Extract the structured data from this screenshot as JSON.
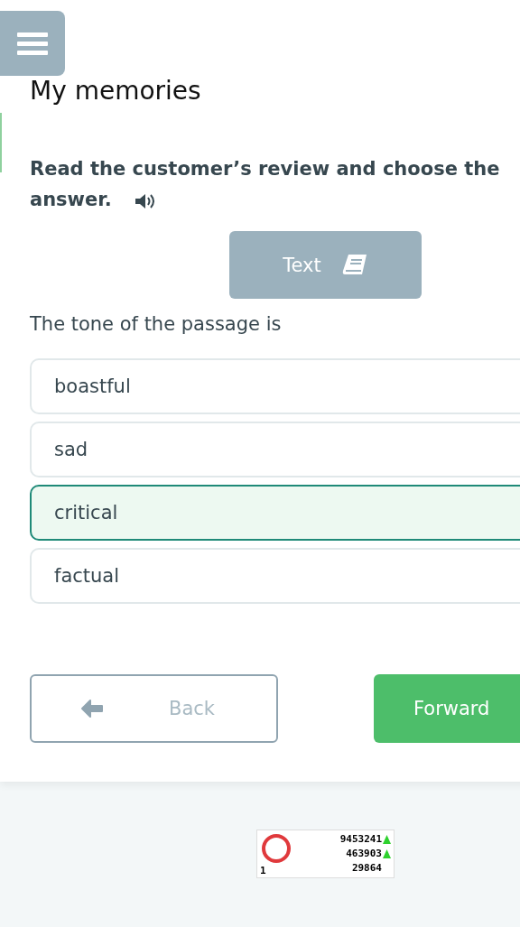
{
  "title": "My memories",
  "instruction": {
    "lines": [
      "Read the customer’s review and choose the",
      "answer."
    ]
  },
  "text_button": {
    "label": "Text"
  },
  "question": "The tone of the passage is",
  "options": [
    {
      "label": "boastful",
      "selected": false
    },
    {
      "label": "sad",
      "selected": false
    },
    {
      "label": "critical",
      "selected": true
    },
    {
      "label": "factual",
      "selected": false
    }
  ],
  "buttons": {
    "back": "Back",
    "forward": "Forward"
  },
  "counter": {
    "rows": [
      {
        "value": "9453241",
        "up": true
      },
      {
        "value": "463903",
        "up": true
      },
      {
        "value": "29864",
        "up": false
      }
    ],
    "index": "1"
  }
}
